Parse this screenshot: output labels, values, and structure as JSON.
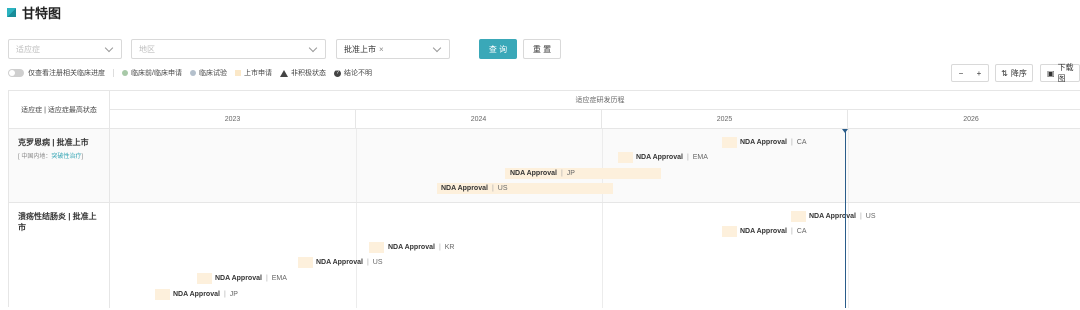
{
  "page": {
    "title": "甘特图"
  },
  "filters": {
    "indication_placeholder": "适应症",
    "region_placeholder": "地区",
    "status_tag": "批准上市",
    "status_tag_close": "×",
    "query_label": "查 询",
    "reset_label": "重 置"
  },
  "legend": {
    "toggle_label": "仅查看注册相关临床进度",
    "items": [
      {
        "label": "临床前/临床申请",
        "color": "#a8c9a8",
        "shape": "dot"
      },
      {
        "label": "临床试验",
        "color": "#b4c0cc",
        "shape": "dot"
      },
      {
        "label": "上市申请",
        "color": "#fbe8c8",
        "shape": "square"
      },
      {
        "label": "非积极状态",
        "shape": "triangle-icon"
      },
      {
        "label": "结论不明",
        "shape": "question-icon"
      }
    ]
  },
  "toolbar": {
    "zoom_out": "−",
    "zoom_in": "+",
    "sort_label": "降序",
    "download_label": "下载图"
  },
  "gantt": {
    "left_header": "适应症 | 适应症最高状态",
    "top_header": "适应症研发历程",
    "years": [
      "2023",
      "2024",
      "2025",
      "2026"
    ],
    "groups": [
      {
        "title": "克罗恩病 | 批准上市",
        "sub_prefix": "[ 中国内地：",
        "sub_link": "突破性治疗",
        "sub_suffix": "]",
        "bars": [
          {
            "name": "NDA Approval",
            "region": "CA"
          },
          {
            "name": "NDA Approval",
            "region": "EMA"
          },
          {
            "name": "NDA Approval",
            "region": "JP"
          },
          {
            "name": "NDA Approval",
            "region": "US"
          }
        ]
      },
      {
        "title": "溃疡性结肠炎 | 批准上市",
        "bars": [
          {
            "name": "NDA Approval",
            "region": "US"
          },
          {
            "name": "NDA Approval",
            "region": "CA"
          },
          {
            "name": "NDA Approval",
            "region": "KR"
          },
          {
            "name": "NDA Approval",
            "region": "US"
          },
          {
            "name": "NDA Approval",
            "region": "EMA"
          },
          {
            "name": "NDA Approval",
            "region": "JP"
          }
        ]
      }
    ]
  },
  "colors": {
    "accent": "#3aa8b8",
    "bar": "#fdf0dc",
    "today_line": "#2a5d8a"
  }
}
